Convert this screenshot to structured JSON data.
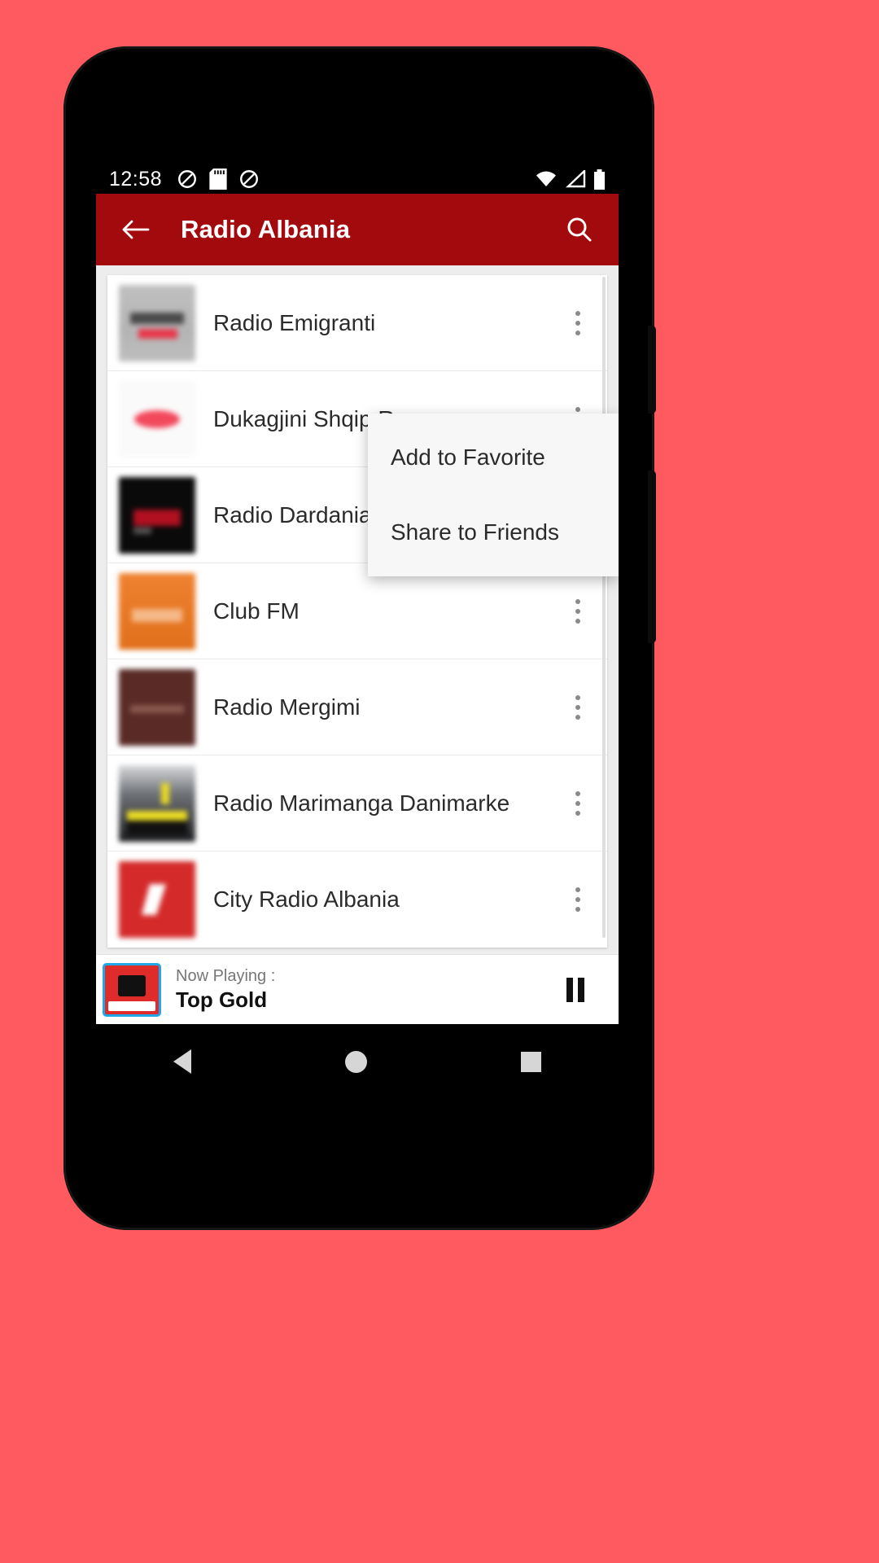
{
  "device": {
    "frame_color": "#000000",
    "wallpaper_color": "#FF5A60"
  },
  "status_bar": {
    "time": "12:58",
    "left_icons": [
      "dnd-icon",
      "sd-card-icon",
      "dnd-icon"
    ],
    "right_icons": [
      "wifi-icon",
      "signal-icon",
      "battery-icon"
    ]
  },
  "app_bar": {
    "back_icon": "arrow-left-icon",
    "title": "Radio Albania",
    "search_icon": "search-icon",
    "background": "#A30A0E",
    "text_color": "#FFFFFF"
  },
  "list": {
    "overflow_icon": "more-vertical-icon",
    "items": [
      {
        "title": "Radio Emigranti",
        "thumb_color": "#B4B4B4",
        "accent": "#E8374B"
      },
      {
        "title": "Dukagjini Shqip Ra",
        "thumb_color": "#FAFAFA",
        "accent": "#F2495C"
      },
      {
        "title": "Radio Dardania",
        "thumb_color": "#0A0A0A",
        "accent": "#B01020"
      },
      {
        "title": "Club FM",
        "thumb_color": "#E1701B",
        "accent": "#F5AE74"
      },
      {
        "title": "Radio Mergimi",
        "thumb_color": "#5A2B26",
        "accent": "#8A5A4C"
      },
      {
        "title": "Radio Marimanga Danimarke",
        "thumb_color": "#2A2C30",
        "accent": "#E8DA25"
      },
      {
        "title": "City Radio Albania",
        "thumb_color": "#D42A2A",
        "accent": "#FFFFFF"
      }
    ]
  },
  "popup_menu": {
    "items": [
      {
        "label": "Add to Favorite"
      },
      {
        "label": "Share to Friends"
      }
    ],
    "background": "#F7F7F7"
  },
  "player": {
    "now_playing_label": "Now Playing :",
    "station": "Top Gold",
    "control_icon": "pause-icon",
    "artwork_border": "#1FA7E8"
  },
  "nav_bar": {
    "back_icon": "nav-back-triangle-icon",
    "home_icon": "nav-home-circle-icon",
    "recents_icon": "nav-recents-square-icon"
  }
}
